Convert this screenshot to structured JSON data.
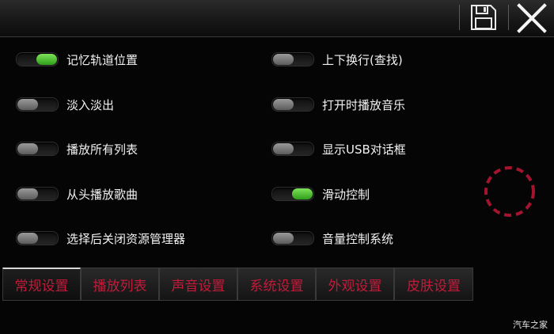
{
  "header": {
    "save_icon": "floppy-disk-icon",
    "close_icon": "close-x-icon"
  },
  "options": {
    "left": [
      {
        "label": "记忆轨道位置",
        "on": true
      },
      {
        "label": "淡入淡出",
        "on": false
      },
      {
        "label": "播放所有列表",
        "on": false
      },
      {
        "label": "从头播放歌曲",
        "on": false
      },
      {
        "label": "选择后关闭资源管理器",
        "on": false
      }
    ],
    "right": [
      {
        "label": "上下换行(查找)",
        "on": false
      },
      {
        "label": "打开时播放音乐",
        "on": false
      },
      {
        "label": "显示USB对话框",
        "on": false
      },
      {
        "label": "滑动控制",
        "on": true
      },
      {
        "label": "音量控制系统",
        "on": false
      }
    ]
  },
  "tabs": [
    {
      "label": "常规设置",
      "active": true
    },
    {
      "label": "播放列表",
      "active": false
    },
    {
      "label": "声音设置",
      "active": false
    },
    {
      "label": "系统设置",
      "active": false
    },
    {
      "label": "外观设置",
      "active": false
    },
    {
      "label": "皮肤设置",
      "active": false
    }
  ],
  "colors": {
    "accent_tab_text": "#c41a3a",
    "toggle_on": "#3fbf22",
    "toggle_off": "#7a7a7a",
    "spinner": "#a3142e"
  },
  "watermark": "汽车之家"
}
